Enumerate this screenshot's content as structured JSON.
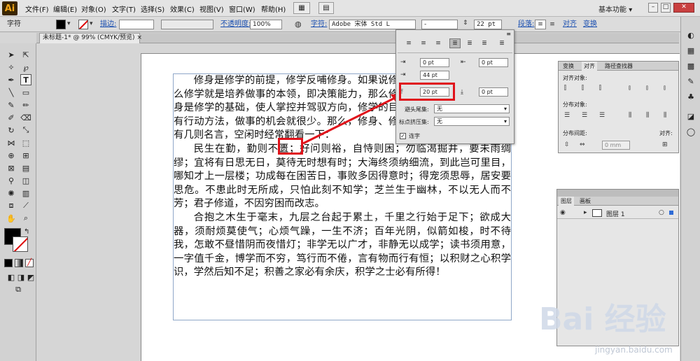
{
  "app": {
    "logo": "Ai"
  },
  "menu": {
    "items": [
      "文件(F)",
      "编辑(E)",
      "对象(O)",
      "文字(T)",
      "选择(S)",
      "效果(C)",
      "视图(V)",
      "窗口(W)",
      "帮助(H)"
    ],
    "workspace": "基本功能",
    "workspace_arrow": "▾"
  },
  "control_bar": {
    "label": "字符",
    "stroke_label": "描边:",
    "opacity_label": "不透明度:",
    "opacity_value": "100%",
    "char_label": "字符:",
    "font_name": "Adobe 宋体 Std L",
    "font_style": "-",
    "font_size": "22 pt",
    "para_label": "段落:",
    "align_label": "对齐",
    "transform_label": "变换"
  },
  "document": {
    "tab_title": "未标题-1* @ 99% (CMYK/预览)",
    "close": "×"
  },
  "text": {
    "paragraphs": [
      "修身是修学的前提，修学反哺修身。如果说修身是做人处事的根本，那么修学就是培养做事的本领，即决策能力，那么修学就是战术能力培养。修身是修学的基础，使人掌控并驾驭方向，修学的目的则是掌握行动方法。没有行动方法，做事的机会就很少。那么，修身、修学应以什么为准呢？这里有几则名言，空闲时经常翻看一下：",
      "民生在勤，勤则不匮；好问则裕，自恃则困；勿临渴掘井，要未雨绸缪；宜将有日思无日，莫待无时想有时；大海终须纳细流，到此岂可里目，哪知才上一层楼；功成每在困苦日，事败多因得意时；得宠须思辱，居安要思危。不患此时无所成，只怕此刻不知学；芝兰生于幽林，不以无人而不芳；君子修道，不因穷困而改志。",
      "合抱之木生于毫末，九层之台起于累土，千里之行始于足下；欲成大器，须耐烦莫使气；心烦气躁，一生不济；百年光阴，似箭如梭，时不待我，怎敢不昼惜阴而夜惜灯；非学无以广才，非静无以成学；读书须用意，一字值千金，博学而不穷，笃行而不倦，言有物而行有恒；以积财之心积学识，学然后知不足；积善之家必有余庆，积学之士必有所得！"
    ],
    "highlight_char": "匮；"
  },
  "paragraph_panel": {
    "left_indent": "0 pt",
    "right_indent": "0 pt",
    "first_indent": "44 pt",
    "space_before": "20 pt",
    "space_after": "0 pt",
    "kinsoku_label": "避头尾集:",
    "kinsoku_value": "无",
    "mojikumi_label": "标点挤压集:",
    "mojikumi_value": "无",
    "hyphen_label": "连字",
    "hyphen_checked": true
  },
  "align_panel": {
    "tabs": [
      "变换",
      "对齐",
      "路径查找器"
    ],
    "align_objects": "对齐对象:",
    "distribute_objects": "分布对象:",
    "distribute_spacing": "分布间距:",
    "align_to": "对齐:",
    "spacing_value": "0 mm"
  },
  "layers_panel": {
    "tabs": [
      "图层",
      "画板"
    ],
    "layer_name": "图层 1"
  },
  "watermark": {
    "main": "Bai 经验",
    "sub": "jingyan.baidu.com"
  },
  "colors": {
    "highlight": "#e0131b",
    "link": "#1a4fb0"
  }
}
